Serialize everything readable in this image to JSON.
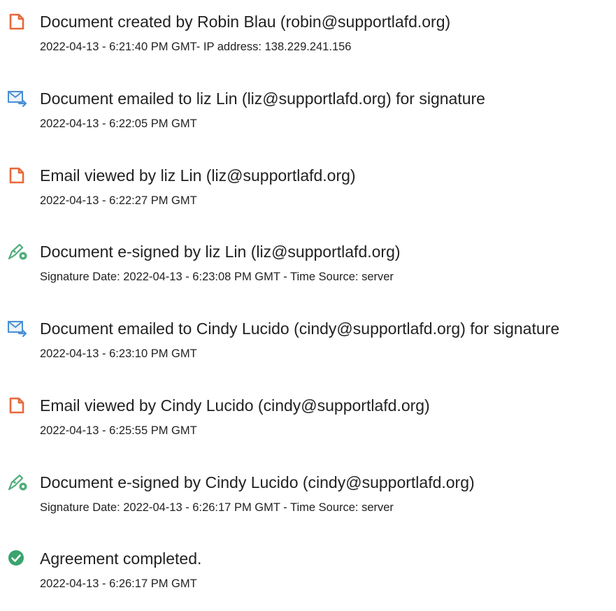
{
  "audit_events": [
    {
      "icon": "document-created-icon",
      "title": "Document created by Robin Blau (robin@supportlafd.org)",
      "detail": "2022-04-13 - 6:21:40 PM GMT- IP address: 138.229.241.156"
    },
    {
      "icon": "email-sent-icon",
      "title": "Document emailed to liz Lin (liz@supportlafd.org) for signature",
      "detail": "2022-04-13 - 6:22:05 PM GMT"
    },
    {
      "icon": "document-viewed-icon",
      "title": "Email viewed by liz Lin (liz@supportlafd.org)",
      "detail": "2022-04-13 - 6:22:27 PM GMT"
    },
    {
      "icon": "e-signature-icon",
      "title": "Document e-signed by liz Lin (liz@supportlafd.org)",
      "detail": "Signature Date: 2022-04-13 - 6:23:08 PM GMT - Time Source: server"
    },
    {
      "icon": "email-sent-icon",
      "title": "Document emailed to Cindy Lucido (cindy@supportlafd.org) for signature",
      "detail": "2022-04-13 - 6:23:10 PM GMT"
    },
    {
      "icon": "document-viewed-icon",
      "title": "Email viewed by Cindy Lucido (cindy@supportlafd.org)",
      "detail": "2022-04-13 - 6:25:55 PM GMT"
    },
    {
      "icon": "e-signature-icon",
      "title": "Document e-signed by Cindy Lucido (cindy@supportlafd.org)",
      "detail": "Signature Date: 2022-04-13 - 6:26:17 PM GMT - Time Source: server"
    },
    {
      "icon": "completed-check-icon",
      "title": "Agreement completed.",
      "detail": "2022-04-13 - 6:26:17 PM GMT"
    }
  ],
  "colors": {
    "document_icon": "#e8683a",
    "email_icon": "#4a8fd4",
    "signature_icon": "#4fae7a",
    "completed_icon": "#3aa36e",
    "text": "#222222"
  }
}
